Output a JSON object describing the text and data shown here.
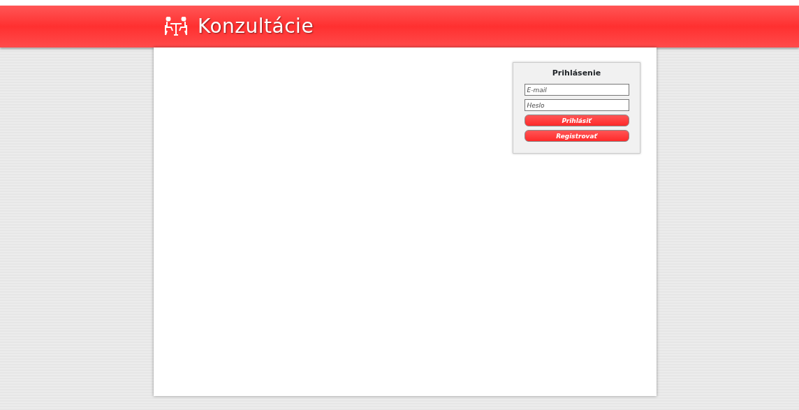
{
  "header": {
    "title": "Konzultácie"
  },
  "login": {
    "title": "Prihlásenie",
    "fields": [
      {
        "placeholder": "E-mail"
      },
      {
        "placeholder": "Heslo"
      }
    ],
    "buttons": [
      "Prihlásiť",
      "Registrovať"
    ]
  }
}
